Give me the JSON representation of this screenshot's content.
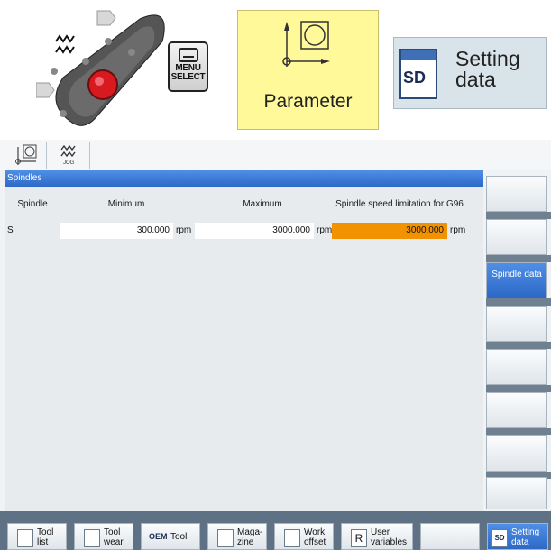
{
  "top": {
    "menu_select": [
      "MENU",
      "SELECT"
    ],
    "parameter_label": "Parameter",
    "setting_data_icon": "SD",
    "setting_data_label": [
      "Setting",
      "data"
    ]
  },
  "screen": {
    "mode_icons": [
      "machine-icon",
      "jog-icon"
    ],
    "title": "Spindles",
    "columns": [
      "Spindle",
      "Minimum",
      "Maximum",
      "Spindle speed limitation for G96"
    ],
    "rows": [
      {
        "spindle": "S",
        "minimum": "300.000",
        "minimum_unit": "rpm",
        "maximum": "3000.000",
        "maximum_unit": "rpm",
        "g96_limit": "3000.000",
        "g96_unit": "rpm"
      }
    ],
    "vertical_softkeys": [
      "",
      "",
      "Spindle data",
      "",
      "",
      "",
      "",
      ""
    ],
    "horizontal_softkeys": [
      {
        "label": [
          "Tool",
          "list"
        ]
      },
      {
        "label": [
          "Tool",
          "wear"
        ]
      },
      {
        "label": [
          "OEM",
          "Tool"
        ]
      },
      {
        "label": [
          "Maga-",
          "zine"
        ]
      },
      {
        "label": [
          "Work",
          "offset"
        ]
      },
      {
        "label": [
          "User",
          "variables"
        ],
        "icon": "R"
      },
      {
        "label": [
          "",
          ""
        ]
      },
      {
        "label": [
          "Setting",
          "data"
        ],
        "icon": "SD"
      }
    ]
  },
  "colors": {
    "accent": "#2d68c7",
    "highlight": "#f39200",
    "key_yellow": "#fff99a"
  }
}
